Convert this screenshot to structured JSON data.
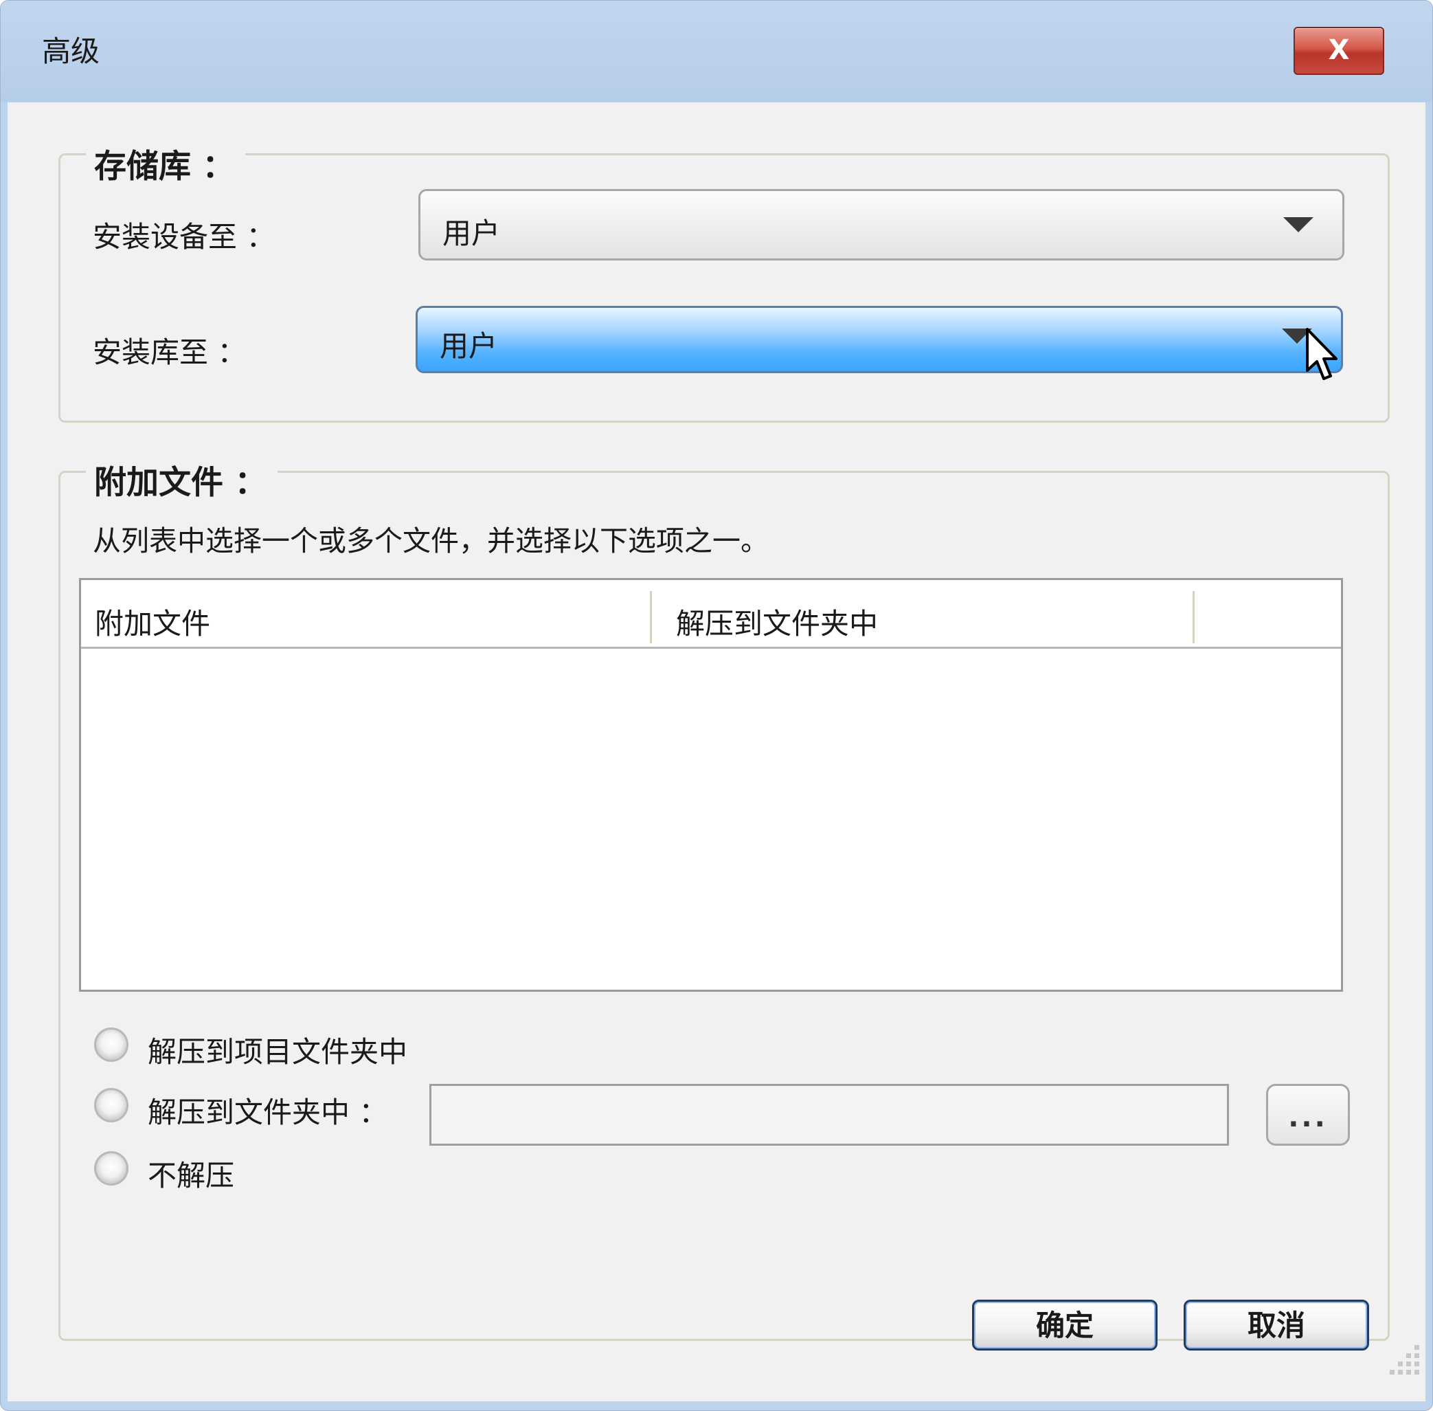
{
  "window": {
    "title": "高级",
    "close_label": "X"
  },
  "repository": {
    "group_title": "存储库 ：",
    "install_device_label": "安装设备至 ：",
    "install_device_value": "用户",
    "install_library_label": "安装库至 ：",
    "install_library_value": "用户"
  },
  "attachments": {
    "group_title": "附加文件 ：",
    "instructions": "从列表中选择一个或多个文件，并选择以下选项之一。",
    "columns": [
      "附加文件",
      "解压到文件夹中"
    ],
    "rows": [],
    "options": [
      {
        "label": "解压到项目文件夹中",
        "selected": false
      },
      {
        "label": "解压到文件夹中 ：",
        "selected": false
      },
      {
        "label": "不解压",
        "selected": false
      }
    ],
    "folder_path_value": "",
    "browse_label": "..."
  },
  "buttons": {
    "ok_label": "确定",
    "cancel_label": "取消"
  },
  "icons": {
    "close": "close-icon",
    "dropdown": "chevron-down-icon",
    "cursor": "mouse-pointer-icon",
    "resize": "resize-grip-icon"
  }
}
